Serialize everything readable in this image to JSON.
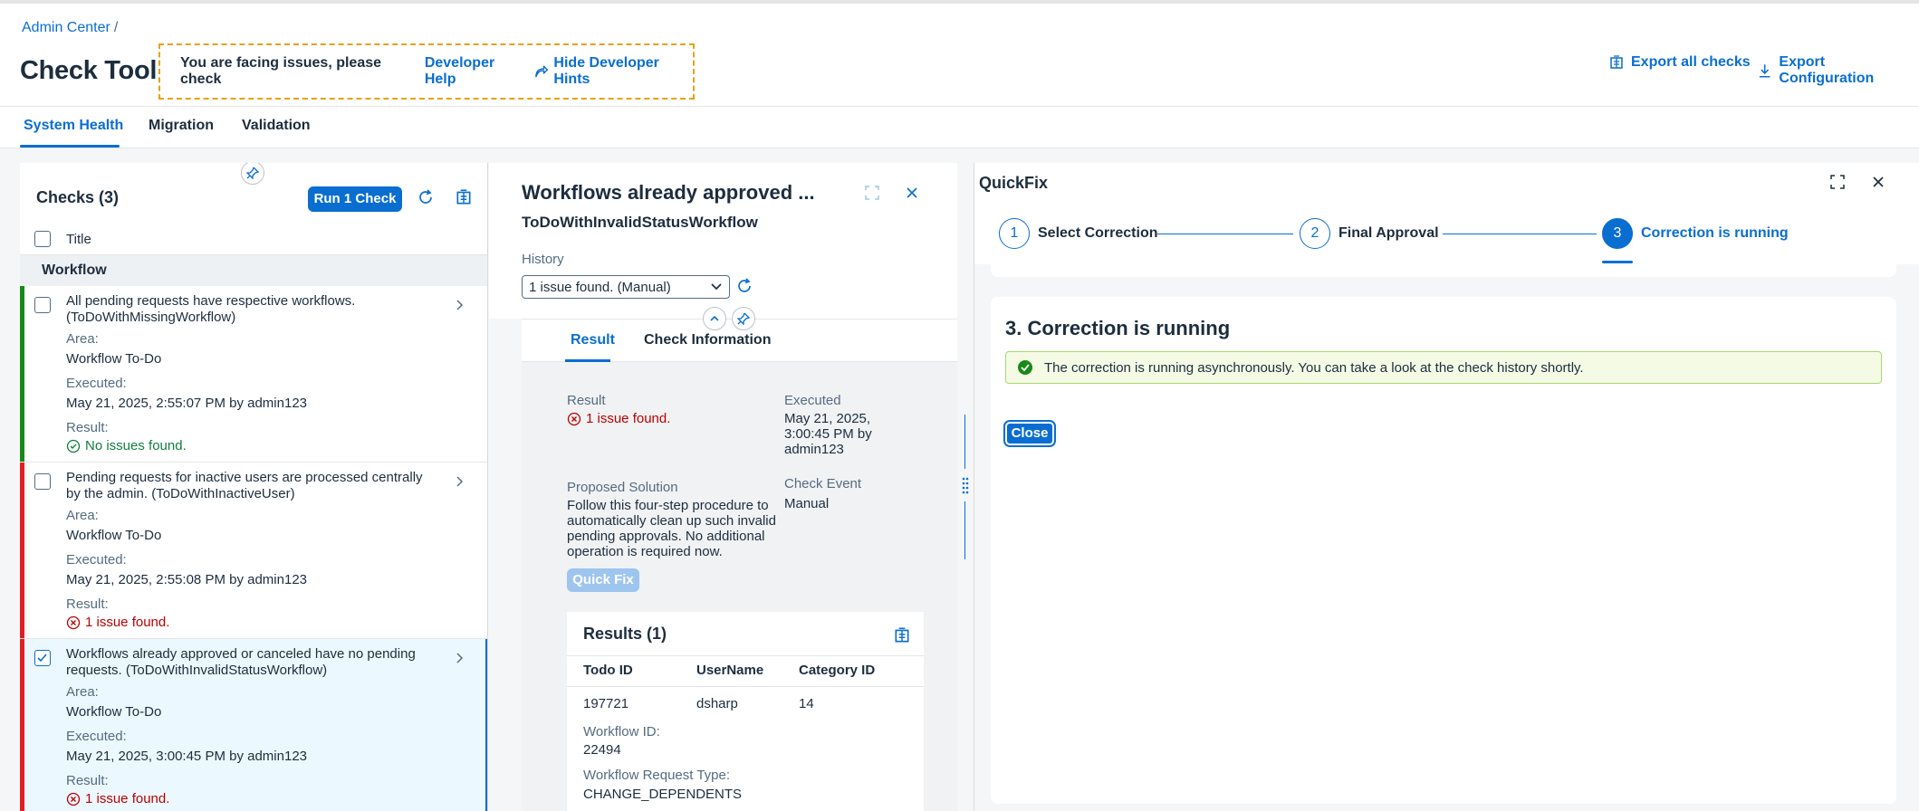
{
  "header": {
    "breadcrumb": "Admin Center",
    "breadcrumb_sep": "/",
    "title": "Check Tool",
    "hint_text": "You are facing issues, please check",
    "developer_help": "Developer Help",
    "hide_hints": "Hide Developer Hints",
    "export_all": "Export all checks",
    "export_config": "Export Configuration"
  },
  "tabs": [
    "System Health",
    "Migration",
    "Validation"
  ],
  "checks": {
    "title": "Checks (3)",
    "run_button": "Run 1 Check",
    "column_title": "Title",
    "group": "Workflow",
    "area_label": "Area:",
    "executed_label": "Executed:",
    "result_label": "Result:",
    "items": [
      {
        "title": "All pending requests have respective workflows. (ToDoWithMissingWorkflow)",
        "area": "Workflow To-Do",
        "executed": "May 21, 2025, 2:55:07 PM by admin123",
        "result": "No issues found.",
        "status": "success",
        "status_color": "#188918"
      },
      {
        "title": "Pending requests for inactive users are processed centrally by the admin. (ToDoWithInactiveUser)",
        "area": "Workflow To-Do",
        "executed": "May 21, 2025, 2:55:08 PM by admin123",
        "result": "1 issue found.",
        "status": "error",
        "status_color": "#e02020"
      },
      {
        "title": "Workflows already approved or canceled have no pending requests. (ToDoWithInvalidStatusWorkflow)",
        "area": "Workflow To-Do",
        "executed": "May 21, 2025, 3:00:45 PM by admin123",
        "result": "1 issue found.",
        "status": "error",
        "status_color": "#e02020"
      }
    ]
  },
  "detail": {
    "title": "Workflows already approved ...",
    "subtitle": "ToDoWithInvalidStatusWorkflow",
    "history_label": "History",
    "history_value": "1 issue found. (Manual)",
    "tabs": [
      "Result",
      "Check Information"
    ],
    "result_label": "Result",
    "result_value": "1 issue found.",
    "executed_label": "Executed",
    "executed_lines": [
      "May 21, 2025,",
      "3:00:45 PM by",
      "admin123"
    ],
    "proposed_label": "Proposed Solution",
    "proposed_lines": [
      "Follow this four-step procedure to",
      "automatically clean up such invalid",
      "pending approvals. No additional",
      "operation is required now."
    ],
    "check_event_label": "Check Event",
    "check_event_value": "Manual",
    "quick_fix_button": "Quick Fix",
    "results_title": "Results (1)",
    "table_headers": [
      "Todo ID",
      "UserName",
      "Category ID"
    ],
    "table_row": [
      "197721",
      "dsharp",
      "14"
    ],
    "workflow_id_label": "Workflow ID:",
    "workflow_id_value": "22494",
    "workflow_type_label": "Workflow Request Type:",
    "workflow_type_value": "CHANGE_DEPENDENTS"
  },
  "quickfix": {
    "title": "QuickFix",
    "steps": [
      {
        "number": "1",
        "label": "Select Correction"
      },
      {
        "number": "2",
        "label": "Final Approval"
      },
      {
        "number": "3",
        "label": "Correction is running"
      }
    ],
    "section_title": "3. Correction is running",
    "message": "The correction is running asynchronously. You can take a look at the check history shortly.",
    "close_button": "Close"
  },
  "colors": {
    "accent": "#0a6ed1",
    "success": "#107e3e",
    "error": "#bb0000",
    "hint_border": "#e9a013"
  },
  "icons": [
    "export-icon",
    "download-icon",
    "share-arrow-icon",
    "refresh-icon",
    "pin-icon",
    "chevron-right-icon",
    "chevron-down-icon",
    "success-icon",
    "error-icon",
    "fullscreen-icon",
    "close-icon",
    "collapse-up-icon",
    "grip-icon"
  ]
}
